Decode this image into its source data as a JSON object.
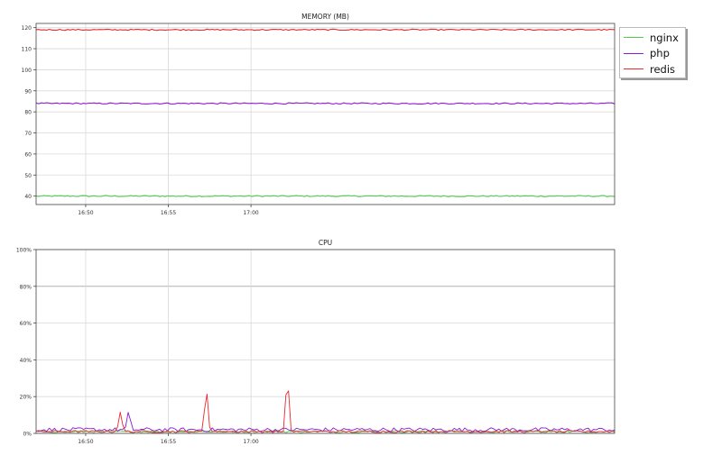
{
  "colors": {
    "nginx": "#4ecb4e",
    "php": "#8a1ccf",
    "redis": "#e8282b",
    "grid": "#d9d9d9",
    "grid_dark": "#b0b0b0",
    "axis": "#444444"
  },
  "legend": {
    "items": [
      {
        "label": "nginx",
        "color": "#4ecb4e"
      },
      {
        "label": "php",
        "color": "#8a1ccf"
      },
      {
        "label": "redis",
        "color": "#e8282b"
      }
    ]
  },
  "chart_data": [
    {
      "type": "line",
      "title": "MEMORY (MB)",
      "xlabel": "",
      "ylabel": "",
      "x_range": [
        "16:47",
        "17:22"
      ],
      "x_ticks": [
        "16:50",
        "16:55",
        "17:00"
      ],
      "ylim": [
        36,
        122
      ],
      "y_ticks": [
        40,
        50,
        60,
        70,
        80,
        90,
        100,
        110,
        120
      ],
      "y_tick_labels": [
        "40",
        "50",
        "60",
        "70",
        "80",
        "90",
        "100",
        "110",
        "120"
      ],
      "grid": true,
      "series": [
        {
          "name": "nginx",
          "approx_value": 40
        },
        {
          "name": "php",
          "approx_value": 84
        },
        {
          "name": "redis",
          "approx_value": 119
        }
      ]
    },
    {
      "type": "line",
      "title": "CPU",
      "xlabel": "",
      "ylabel": "",
      "x_range": [
        "16:47",
        "17:22"
      ],
      "x_ticks": [
        "16:50",
        "16:55",
        "17:00"
      ],
      "ylim": [
        0,
        100
      ],
      "y_ticks": [
        0,
        20,
        40,
        60,
        80,
        100
      ],
      "y_tick_labels": [
        "0%",
        "20%",
        "40%",
        "60%",
        "80%",
        "100%"
      ],
      "grid": true,
      "series": [
        {
          "name": "nginx",
          "approx_value": 1
        },
        {
          "name": "php",
          "approx_value": 2,
          "spikes": [
            {
              "x": "16:52.6",
              "y": 13
            }
          ]
        },
        {
          "name": "redis",
          "approx_value": 1,
          "spikes": [
            {
              "x": "16:52.1",
              "y": 12
            },
            {
              "x": "16:57.3",
              "y": 26
            },
            {
              "x": "17:02.2",
              "y": 34
            }
          ]
        }
      ]
    }
  ]
}
